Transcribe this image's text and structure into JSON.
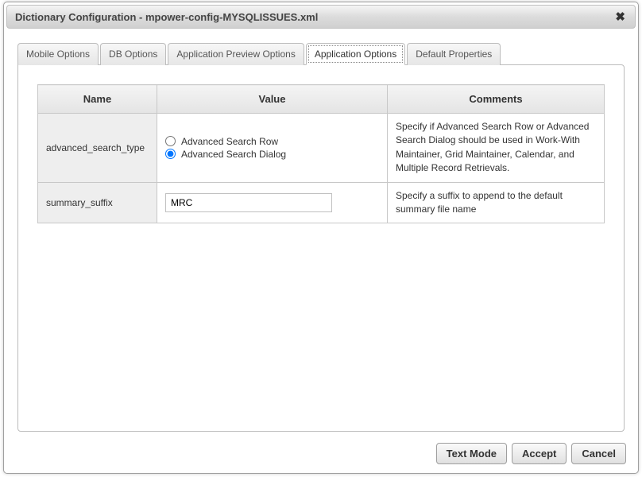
{
  "dialog": {
    "title": "Dictionary Configuration - mpower-config-MYSQLISSUES.xml"
  },
  "tabs": [
    {
      "label": "Mobile Options",
      "active": false
    },
    {
      "label": "DB Options",
      "active": false
    },
    {
      "label": "Application Preview Options",
      "active": false
    },
    {
      "label": "Application Options",
      "active": true
    },
    {
      "label": "Default Properties",
      "active": false
    }
  ],
  "columns": {
    "name": "Name",
    "value": "Value",
    "comments": "Comments"
  },
  "rows": [
    {
      "name": "advanced_search_type",
      "value_type": "radio",
      "options": [
        {
          "label": "Advanced Search Row",
          "checked": false
        },
        {
          "label": "Advanced Search Dialog",
          "checked": true
        }
      ],
      "comments": "Specify if Advanced Search Row or Advanced Search Dialog should be used in Work-With Maintainer, Grid Maintainer, Calendar, and Multiple Record Retrievals."
    },
    {
      "name": "summary_suffix",
      "value_type": "text",
      "value": "MRC",
      "comments": "Specify a suffix to append to the default summary file name"
    }
  ],
  "buttons": {
    "text_mode": "Text Mode",
    "accept": "Accept",
    "cancel": "Cancel"
  }
}
